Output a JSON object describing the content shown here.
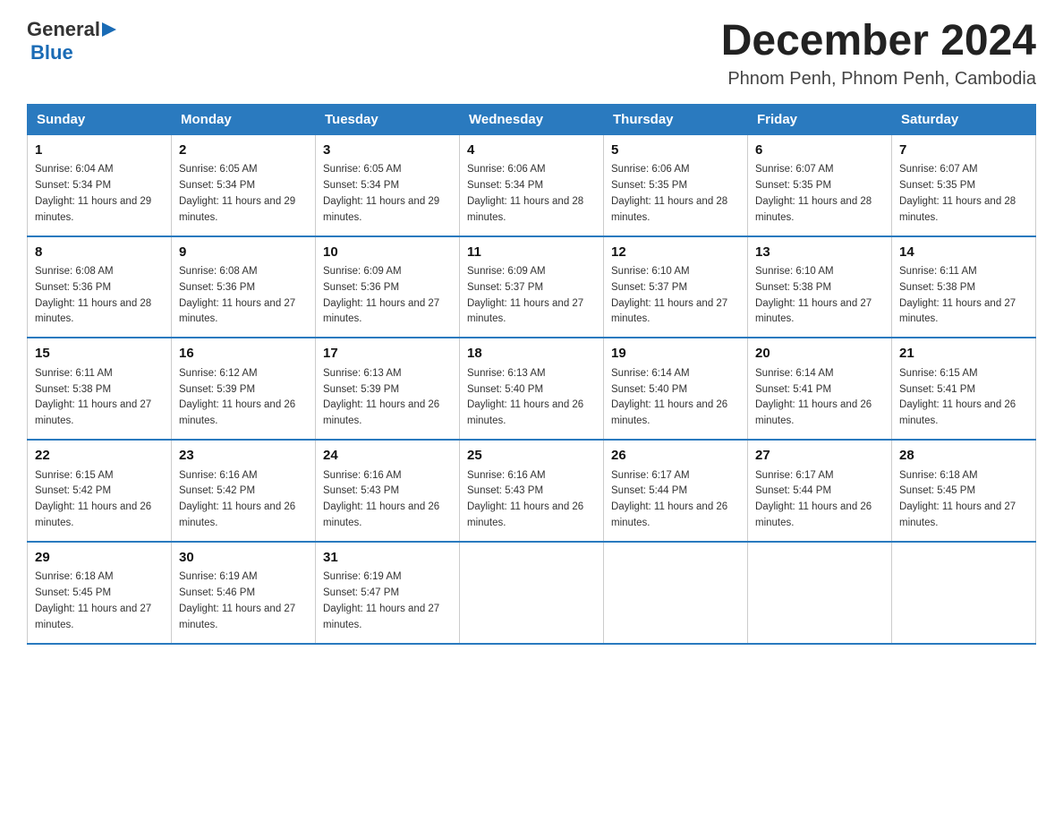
{
  "logo": {
    "text_general": "General",
    "text_blue": "Blue"
  },
  "title": "December 2024",
  "subtitle": "Phnom Penh, Phnom Penh, Cambodia",
  "days_of_week": [
    "Sunday",
    "Monday",
    "Tuesday",
    "Wednesday",
    "Thursday",
    "Friday",
    "Saturday"
  ],
  "weeks": [
    [
      {
        "day": "1",
        "sunrise": "6:04 AM",
        "sunset": "5:34 PM",
        "daylight": "11 hours and 29 minutes."
      },
      {
        "day": "2",
        "sunrise": "6:05 AM",
        "sunset": "5:34 PM",
        "daylight": "11 hours and 29 minutes."
      },
      {
        "day": "3",
        "sunrise": "6:05 AM",
        "sunset": "5:34 PM",
        "daylight": "11 hours and 29 minutes."
      },
      {
        "day": "4",
        "sunrise": "6:06 AM",
        "sunset": "5:34 PM",
        "daylight": "11 hours and 28 minutes."
      },
      {
        "day": "5",
        "sunrise": "6:06 AM",
        "sunset": "5:35 PM",
        "daylight": "11 hours and 28 minutes."
      },
      {
        "day": "6",
        "sunrise": "6:07 AM",
        "sunset": "5:35 PM",
        "daylight": "11 hours and 28 minutes."
      },
      {
        "day": "7",
        "sunrise": "6:07 AM",
        "sunset": "5:35 PM",
        "daylight": "11 hours and 28 minutes."
      }
    ],
    [
      {
        "day": "8",
        "sunrise": "6:08 AM",
        "sunset": "5:36 PM",
        "daylight": "11 hours and 28 minutes."
      },
      {
        "day": "9",
        "sunrise": "6:08 AM",
        "sunset": "5:36 PM",
        "daylight": "11 hours and 27 minutes."
      },
      {
        "day": "10",
        "sunrise": "6:09 AM",
        "sunset": "5:36 PM",
        "daylight": "11 hours and 27 minutes."
      },
      {
        "day": "11",
        "sunrise": "6:09 AM",
        "sunset": "5:37 PM",
        "daylight": "11 hours and 27 minutes."
      },
      {
        "day": "12",
        "sunrise": "6:10 AM",
        "sunset": "5:37 PM",
        "daylight": "11 hours and 27 minutes."
      },
      {
        "day": "13",
        "sunrise": "6:10 AM",
        "sunset": "5:38 PM",
        "daylight": "11 hours and 27 minutes."
      },
      {
        "day": "14",
        "sunrise": "6:11 AM",
        "sunset": "5:38 PM",
        "daylight": "11 hours and 27 minutes."
      }
    ],
    [
      {
        "day": "15",
        "sunrise": "6:11 AM",
        "sunset": "5:38 PM",
        "daylight": "11 hours and 27 minutes."
      },
      {
        "day": "16",
        "sunrise": "6:12 AM",
        "sunset": "5:39 PM",
        "daylight": "11 hours and 26 minutes."
      },
      {
        "day": "17",
        "sunrise": "6:13 AM",
        "sunset": "5:39 PM",
        "daylight": "11 hours and 26 minutes."
      },
      {
        "day": "18",
        "sunrise": "6:13 AM",
        "sunset": "5:40 PM",
        "daylight": "11 hours and 26 minutes."
      },
      {
        "day": "19",
        "sunrise": "6:14 AM",
        "sunset": "5:40 PM",
        "daylight": "11 hours and 26 minutes."
      },
      {
        "day": "20",
        "sunrise": "6:14 AM",
        "sunset": "5:41 PM",
        "daylight": "11 hours and 26 minutes."
      },
      {
        "day": "21",
        "sunrise": "6:15 AM",
        "sunset": "5:41 PM",
        "daylight": "11 hours and 26 minutes."
      }
    ],
    [
      {
        "day": "22",
        "sunrise": "6:15 AM",
        "sunset": "5:42 PM",
        "daylight": "11 hours and 26 minutes."
      },
      {
        "day": "23",
        "sunrise": "6:16 AM",
        "sunset": "5:42 PM",
        "daylight": "11 hours and 26 minutes."
      },
      {
        "day": "24",
        "sunrise": "6:16 AM",
        "sunset": "5:43 PM",
        "daylight": "11 hours and 26 minutes."
      },
      {
        "day": "25",
        "sunrise": "6:16 AM",
        "sunset": "5:43 PM",
        "daylight": "11 hours and 26 minutes."
      },
      {
        "day": "26",
        "sunrise": "6:17 AM",
        "sunset": "5:44 PM",
        "daylight": "11 hours and 26 minutes."
      },
      {
        "day": "27",
        "sunrise": "6:17 AM",
        "sunset": "5:44 PM",
        "daylight": "11 hours and 26 minutes."
      },
      {
        "day": "28",
        "sunrise": "6:18 AM",
        "sunset": "5:45 PM",
        "daylight": "11 hours and 27 minutes."
      }
    ],
    [
      {
        "day": "29",
        "sunrise": "6:18 AM",
        "sunset": "5:45 PM",
        "daylight": "11 hours and 27 minutes."
      },
      {
        "day": "30",
        "sunrise": "6:19 AM",
        "sunset": "5:46 PM",
        "daylight": "11 hours and 27 minutes."
      },
      {
        "day": "31",
        "sunrise": "6:19 AM",
        "sunset": "5:47 PM",
        "daylight": "11 hours and 27 minutes."
      },
      null,
      null,
      null,
      null
    ]
  ]
}
